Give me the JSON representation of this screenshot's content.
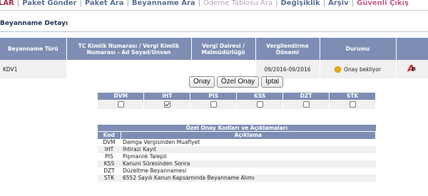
{
  "nav": {
    "items": [
      {
        "label": "LAR",
        "style": "first"
      },
      {
        "label": "Paket Gönder",
        "style": "normal"
      },
      {
        "label": "Paket Ara",
        "style": "normal"
      },
      {
        "label": "Beyanname Ara",
        "style": "normal"
      },
      {
        "label": "Ödeme Tablosu Ara",
        "style": "light"
      },
      {
        "label": "Değişiklik",
        "style": "normal"
      },
      {
        "label": "Arşiv",
        "style": "normal"
      },
      {
        "label": "Güvenli Çıkış",
        "style": "pink"
      }
    ],
    "separator": "|"
  },
  "panel": {
    "title": "Beyanname Detayı"
  },
  "declaration_table": {
    "headers": [
      "Beyanname Türü",
      "TC Kimlik Numarası / Vergi Kimlik Numarası - Ad Soyad/Unvan",
      "Vergi Dairesi / Malmüdürlüğü",
      "Vergilendirme Dönemi",
      "Durumu",
      ""
    ],
    "row": {
      "type": "KDV1",
      "tc_vkn": "",
      "tax_office": "",
      "period": "09/2016-09/2016",
      "status": "Onay bekliyor",
      "status_icon": "yellow-dot-icon",
      "doc_icon": "pdf-icon"
    }
  },
  "actions": {
    "approve": "Onay",
    "special_approve": "Özel Onay",
    "cancel": "İptal"
  },
  "approval_checks": {
    "columns": [
      {
        "code": "DVM",
        "checked": false
      },
      {
        "code": "IHT",
        "checked": true
      },
      {
        "code": "PIS",
        "checked": false
      },
      {
        "code": "KSS",
        "checked": false
      },
      {
        "code": "DZT",
        "checked": false
      },
      {
        "code": "STK",
        "checked": false
      }
    ]
  },
  "codes_table": {
    "title": "Özel Onay Kodları ve Açıklamaları",
    "headers": {
      "code": "Kod",
      "description": "Açıklama"
    },
    "rows": [
      {
        "code": "DVM",
        "description": "Damga Vergisinden Muafiyet"
      },
      {
        "code": "IHT",
        "description": "İhtirazi Kayıt"
      },
      {
        "code": "PIS",
        "description": "Pişmanlık Talepli"
      },
      {
        "code": "KSS",
        "description": "Kanuni Süresinden Sonra"
      },
      {
        "code": "DZT",
        "description": "Düzeltme Beyannamesi"
      },
      {
        "code": "STK",
        "description": "6552 Sayılı Kanun Kapsamında Beyanname Alımı"
      }
    ]
  },
  "colors": {
    "header_bg": "#7d8db3",
    "nav_text": "#5a6e97",
    "row_bg": "#f0f0f0",
    "status_dot": "#f1b000"
  }
}
